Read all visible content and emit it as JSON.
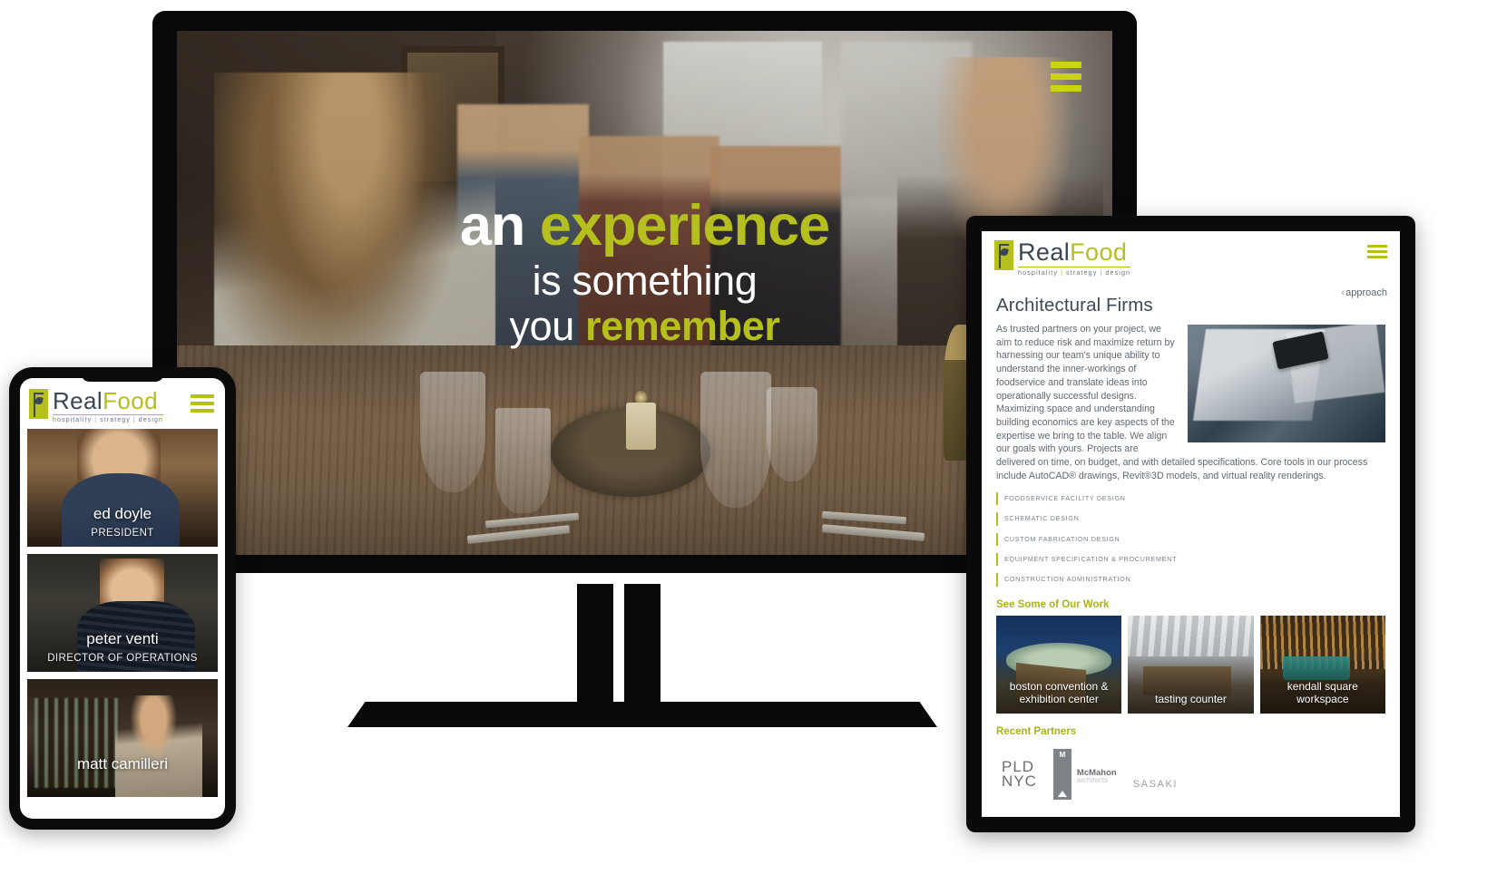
{
  "brand": {
    "name_dark": "Real",
    "name_green": "Food",
    "tagline_1": "hospitality",
    "tagline_2": "strategy",
    "tagline_3": "design",
    "sep": "|",
    "accent_green": "#b5bf1e",
    "accent_dark": "#3b4654"
  },
  "monitor": {
    "hero": {
      "menu_icon": "hamburger-menu-icon",
      "line1_white": "an ",
      "line1_green": "experience",
      "line2": "is something",
      "line3_white": "you ",
      "line3_green": "remember"
    }
  },
  "tablet": {
    "menu_icon": "hamburger-menu-icon",
    "back_chevron": "‹",
    "back_label": "approach",
    "heading": "Architectural Firms",
    "paragraph": "As trusted partners on your project, we aim to reduce risk and maximize return by harnessing our team's unique ability to understand the inner-workings of foodservice and translate ideas into operationally successful designs. Maximizing space and understanding building economics are key aspects of the expertise we bring to the table. We align our goals with yours. Projects are delivered on time, on budget, and with detailed specifications. Core tools in our process include AutoCAD® drawings, Revit®3D models, and virtual reality renderings.",
    "services": [
      "FOODSERVICE FACILITY DESIGN",
      "SCHEMATIC DESIGN",
      "CUSTOM FABRICATION DESIGN",
      "EQUIPMENT SPECIFICATION & PROCUREMENT",
      "CONSTRUCTION ADMINISTRATION"
    ],
    "work_title": "See Some of Our Work",
    "work": [
      {
        "label": "boston convention & exhibition center"
      },
      {
        "label": "tasting counter"
      },
      {
        "label": "kendall square workspace"
      }
    ],
    "partners_title": "Recent Partners",
    "partners": {
      "pld_line1": "PLD",
      "pld_line2": "NYC",
      "mcmahon_mark": "M",
      "mcmahon_name": "McMahon",
      "mcmahon_sub": "architects",
      "sasaki": "SASAKI"
    }
  },
  "phone": {
    "menu_icon": "hamburger-menu-icon",
    "team": [
      {
        "name": "ed doyle",
        "role": "PRESIDENT"
      },
      {
        "name": "peter venti",
        "role": "DIRECTOR OF OPERATIONS"
      },
      {
        "name": "matt camilleri",
        "role": ""
      }
    ]
  }
}
